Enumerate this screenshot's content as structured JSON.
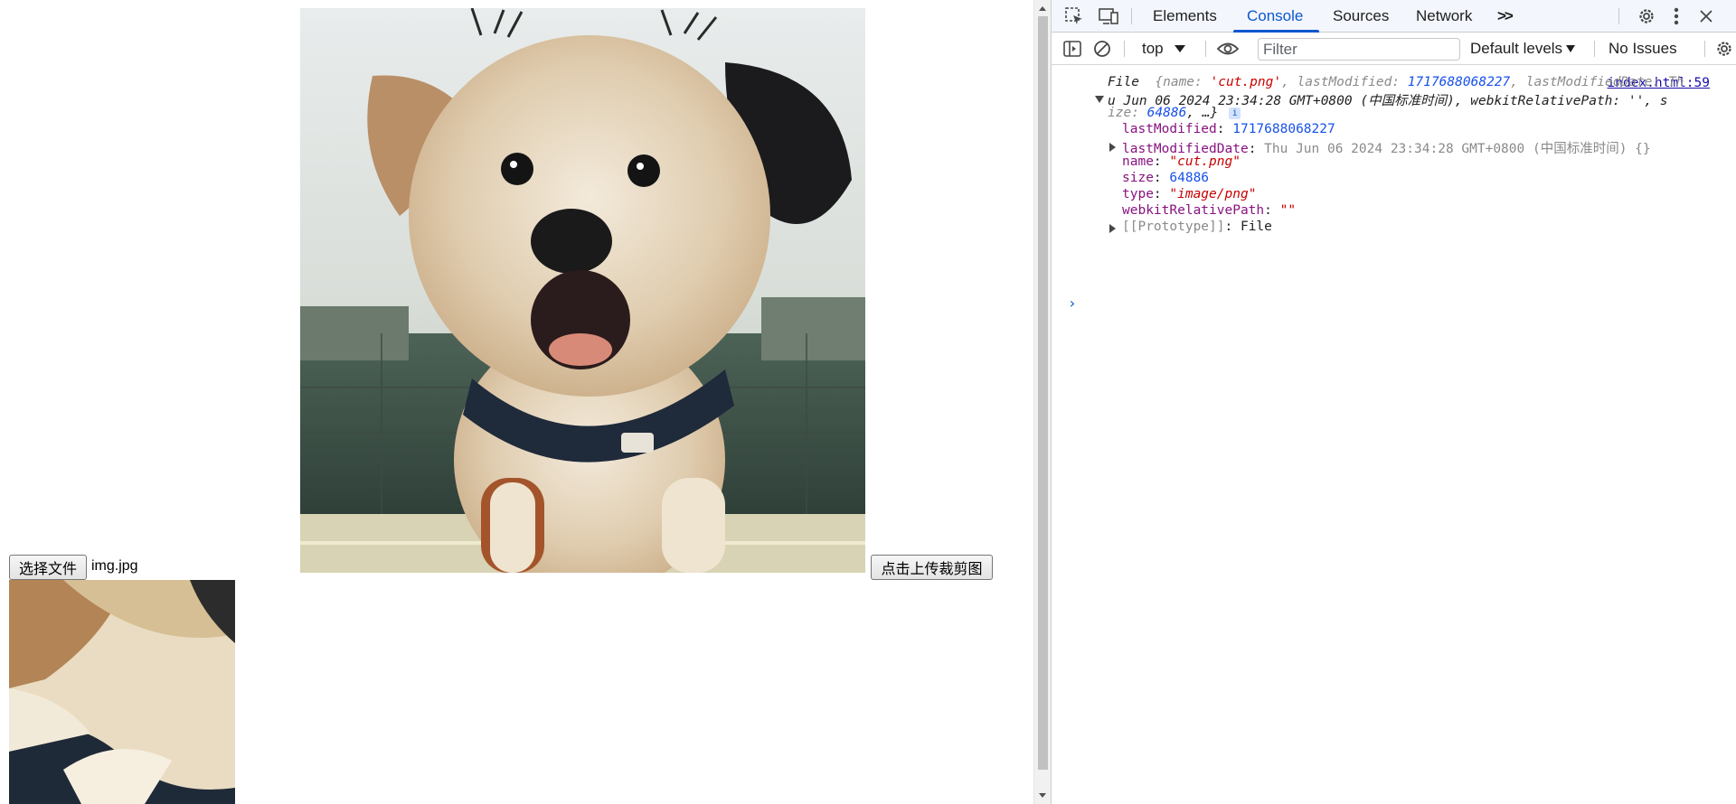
{
  "page": {
    "file_button_label": "选择文件",
    "file_name": "img.jpg",
    "upload_button_label": "点击上传裁剪图"
  },
  "devtools": {
    "tabs": [
      {
        "label": "Elements",
        "active": false
      },
      {
        "label": "Console",
        "active": true
      },
      {
        "label": "Sources",
        "active": false
      },
      {
        "label": "Network",
        "active": false
      }
    ],
    "more_tabs_label": ">>",
    "toolbar": {
      "context": "top",
      "filter_placeholder": "Filter",
      "levels_label": "Default levels",
      "issues_label": "No Issues"
    },
    "console": {
      "source_link": "index.html:59",
      "summary": {
        "prefix": "File",
        "line1_a": "{name: ",
        "name_value": "'cut.png'",
        "line1_b": ", lastModified: ",
        "last_modified_value": "1717688068227",
        "line1_c": ", lastModifiedDate: Th",
        "line2": "u Jun 06 2024 23:34:28 GMT+0800 (中国标准时间), webkitRelativePath: '', s",
        "line3_a": "ize: ",
        "size_value": "64886",
        "line3_b": ", …}",
        "info_badge": "i"
      },
      "properties": [
        {
          "key": "lastModified",
          "value": "1717688068227",
          "type": "number",
          "expandable": false
        },
        {
          "key": "lastModifiedDate",
          "value": "Thu Jun 06 2024 23:34:28 GMT+0800 (中国标准时间)  {}",
          "type": "object",
          "expandable": true
        },
        {
          "key": "name",
          "value": "\"cut.png\"",
          "type": "string",
          "expandable": false
        },
        {
          "key": "size",
          "value": "64886",
          "type": "number",
          "expandable": false
        },
        {
          "key": "type",
          "value": "\"image/png\"",
          "type": "string",
          "expandable": false
        },
        {
          "key": "webkitRelativePath",
          "value": "\"\"",
          "type": "string",
          "expandable": false
        },
        {
          "key": "[[Prototype]]",
          "value": "File",
          "type": "proto",
          "expandable": true
        }
      ],
      "prompt_glyph": "›"
    }
  },
  "colors": {
    "devtools_accent": "#0b57d0",
    "key_purple": "#881280",
    "number_blue": "#1750eb",
    "string_red": "#c80000"
  }
}
